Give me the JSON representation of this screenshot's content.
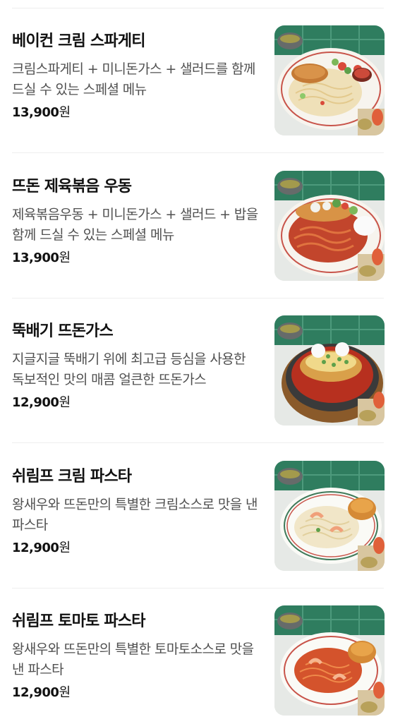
{
  "menu": {
    "items": [
      {
        "name": "베이컨 크림 스파게티",
        "description": "크림스파게티 + 미니돈가스 + 샐러드를 함께 드실 수 있는 스페셜 메뉴",
        "price": "13,900",
        "currency": "원",
        "photo": "bacon-cream-spaghetti-photo"
      },
      {
        "name": "뜨돈 제육볶음 우동",
        "description": "제육볶음우동 + 미니돈가스 + 샐러드 + 밥을 함께 드실 수 있는 스페셜 메뉴",
        "price": "13,900",
        "currency": "원",
        "photo": "spicy-pork-udon-photo"
      },
      {
        "name": "뚝배기 뜨돈가스",
        "description": "지글지글 뚝배기 위에 최고급 등심을 사용한 독보적인 맛의 매콤 얼큰한 뜨돈가스",
        "price": "12,900",
        "currency": "원",
        "photo": "ttukbaegi-tonkatsu-photo"
      },
      {
        "name": "쉬림프 크림 파스타",
        "description": "왕새우와 뜨돈만의 특별한 크림소스로 맛을 낸 파스타",
        "price": "12,900",
        "currency": "원",
        "photo": "shrimp-cream-pasta-photo"
      },
      {
        "name": "쉬림프 토마토 파스타",
        "description": "왕새우와 뜨돈만의 특별한 토마토소스로 맛을 낸 파스타",
        "price": "12,900",
        "currency": "원",
        "photo": "shrimp-tomato-pasta-photo"
      }
    ]
  }
}
